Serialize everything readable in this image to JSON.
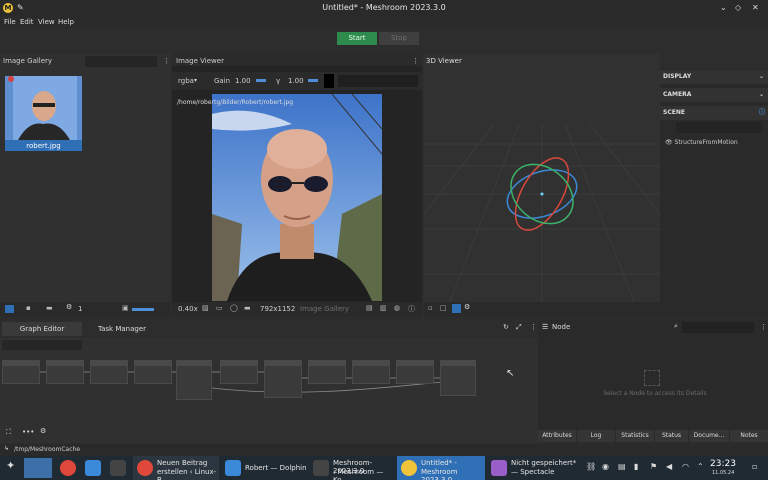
{
  "window": {
    "title": "Untitled* - Meshroom 2023.3.0",
    "app_icon_glyph": "M"
  },
  "menu": [
    "File",
    "Edit",
    "View",
    "Help"
  ],
  "run": {
    "start_label": "Start",
    "stop_label": "Stop"
  },
  "gallery": {
    "header": "Image Gallery",
    "thumbnail_label": "robert.jpg",
    "footer_count": "1"
  },
  "image_viewer": {
    "header": "Image Viewer",
    "channel": "rgba",
    "gain_label": "Gain",
    "gain_value": "1.00",
    "gamma_label": "γ",
    "gamma_value": "1.00",
    "path": "/home/robertg/Bilder/Robert/robert.jpg",
    "zoom": "0.40x",
    "resolution": "792x1152",
    "source": "Image Gallery"
  },
  "viewer3d": {
    "header": "3D Viewer",
    "sections": [
      "DISPLAY",
      "CAMERA",
      "SCENE"
    ],
    "scene_item": "StructureFromMotion"
  },
  "graph": {
    "tabs": [
      "Graph Editor",
      "Task Manager"
    ]
  },
  "node_panel": {
    "header": "Node",
    "hint": "Select a Node to access its Details",
    "tabs": [
      "Attributes",
      "Log",
      "Statistics",
      "Status",
      "Docume...",
      "Notes"
    ]
  },
  "status": {
    "path": "/tmp/MeshroomCache"
  },
  "taskbar": {
    "items": [
      {
        "label_1": "Neuen Beitrag",
        "label_2": "erstellen ‹ Linux-B..."
      },
      {
        "label_1": "Robert — Dolphin",
        "label_2": ""
      },
      {
        "label_1": "Meshroom-2023.3.0",
        "label_2": ": Meshroom — Ko..."
      },
      {
        "label_1": "Untitled* -",
        "label_2": "Meshroom 2023.3.0"
      },
      {
        "label_1": "Nicht gespeichert*",
        "label_2": "— Spectacle"
      }
    ],
    "time": "23:23",
    "date": "11.05.24"
  },
  "colors": {
    "start_green": "#2e8b4e",
    "selection_blue": "#2f6fb5",
    "taskbar": "#1f2a33"
  }
}
